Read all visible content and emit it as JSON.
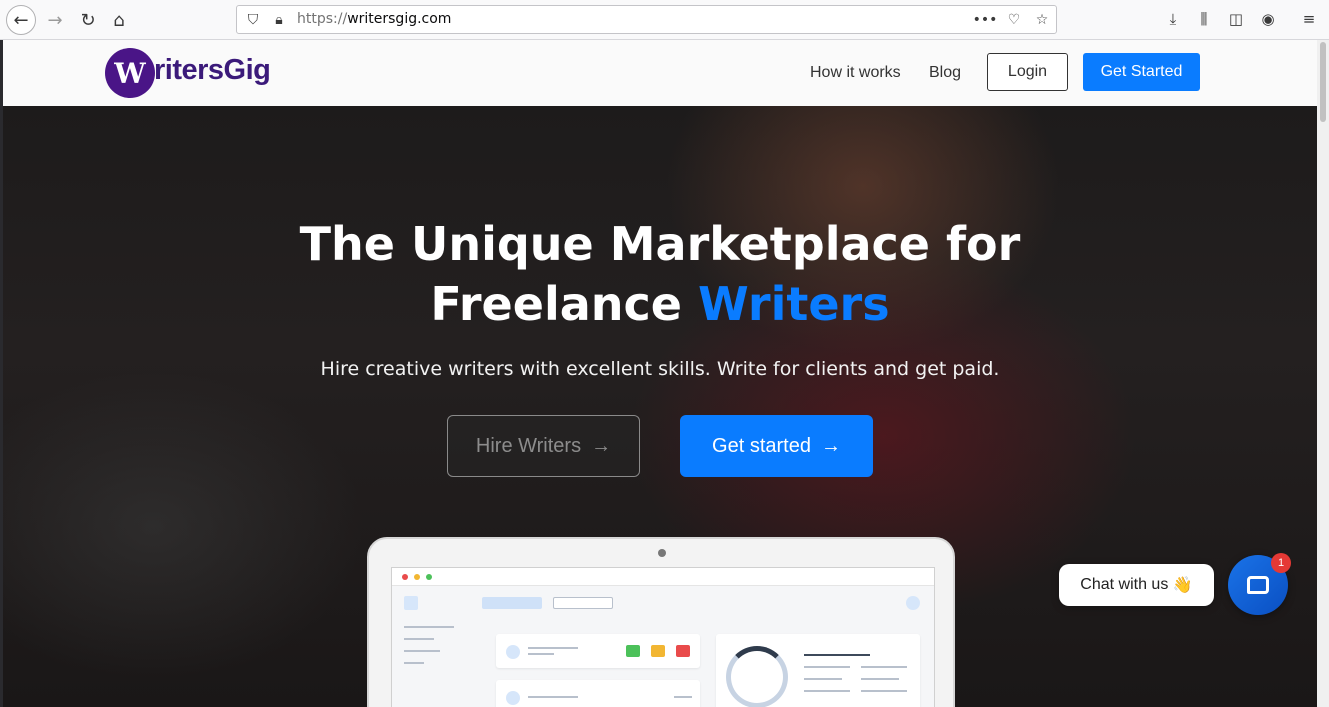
{
  "browser": {
    "url_scheme": "https://",
    "url_host": "writersgig.com",
    "icons": {
      "back": "back-arrow-icon",
      "forward": "forward-arrow-icon",
      "reload": "reload-icon",
      "home": "home-icon",
      "shield": "shield-icon",
      "lock": "lock-icon",
      "more": "more-dots-icon",
      "pocket": "pocket-icon",
      "bookmark": "star-icon",
      "download": "download-icon",
      "library": "library-icon",
      "sidebar": "sidebar-icon",
      "account": "account-icon",
      "menu": "hamburger-menu-icon"
    }
  },
  "header": {
    "logo_letter": "W",
    "logo_text": "ritersGig",
    "nav": {
      "how_it_works": "How it works",
      "blog": "Blog",
      "login": "Login",
      "get_started": "Get Started"
    }
  },
  "hero": {
    "title_line1": "The Unique Marketplace for",
    "title_line2_plain": "Freelance ",
    "title_line2_accent": "Writers",
    "subtitle": "Hire creative writers with excellent skills. Write for clients and get paid.",
    "hire_button": "Hire Writers",
    "start_button": "Get started",
    "arrow": "→"
  },
  "chat": {
    "label": "Chat with us",
    "emoji": "👋",
    "badge": "1"
  },
  "colors": {
    "accent": "#0a7cff",
    "logo": "#4a1587",
    "badge": "#e53935"
  }
}
